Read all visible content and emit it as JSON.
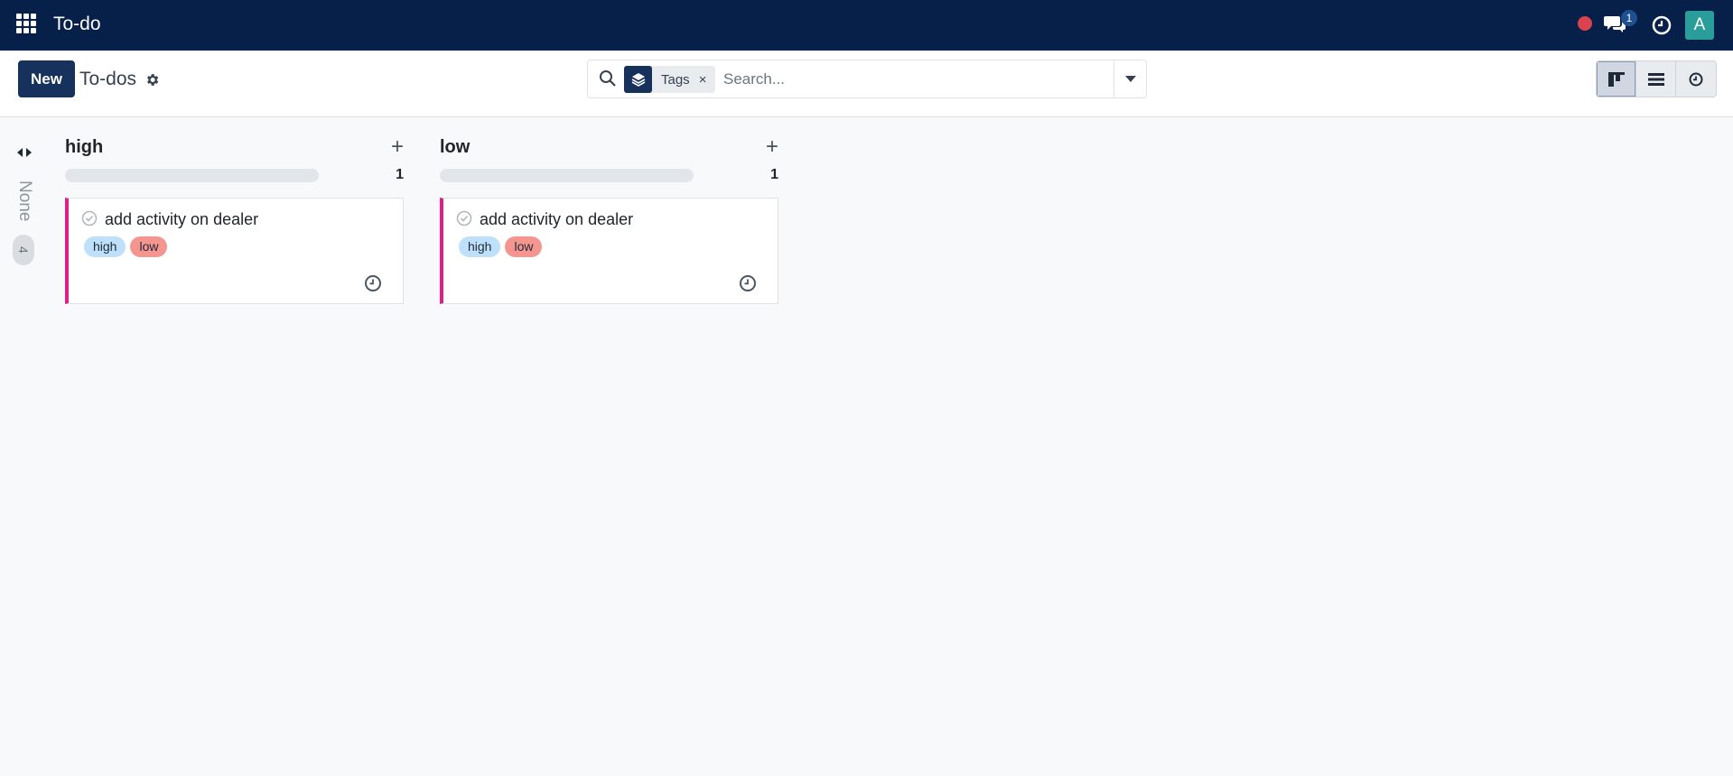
{
  "navbar": {
    "app_title": "To-do",
    "chat_badge": "1",
    "avatar_letter": "A",
    "status_color": "#d9434d",
    "bg_color": "#06204a"
  },
  "control": {
    "new_label": "New",
    "breadcrumb": "To-dos",
    "search": {
      "facet_label": "Tags",
      "facet_remove": "×",
      "placeholder": "Search..."
    },
    "views": [
      "kanban-icon",
      "list-icon",
      "activity-icon"
    ]
  },
  "kanban": {
    "folded_column": {
      "label": "None",
      "count": "4"
    },
    "columns": [
      {
        "title": "high",
        "count": "1",
        "cards": [
          {
            "title": "add activity on dealer",
            "tags": [
              "high",
              "low"
            ]
          }
        ]
      },
      {
        "title": "low",
        "count": "1",
        "cards": [
          {
            "title": "add activity on dealer",
            "tags": [
              "high",
              "low"
            ]
          }
        ]
      }
    ]
  }
}
